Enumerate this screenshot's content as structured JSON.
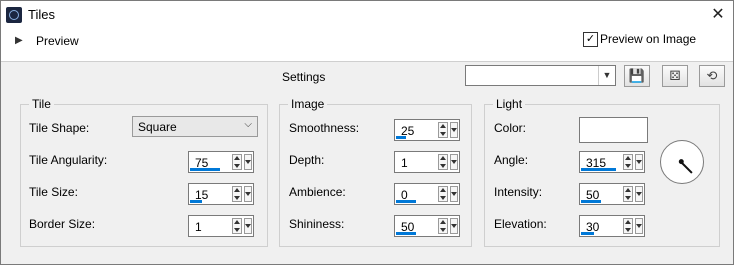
{
  "window": {
    "title": "Tiles",
    "close_label": "✕"
  },
  "preview": {
    "label": "Preview",
    "preview_on_image_label": "Preview on Image",
    "preview_on_image_checked": true
  },
  "settings": {
    "label": "Settings",
    "preset_value": ""
  },
  "toolbar": {
    "icons": [
      "save-icon",
      "randomize-icon",
      "reset-icon"
    ]
  },
  "tile": {
    "title": "Tile",
    "shape_label": "Tile Shape:",
    "shape_value": "Square",
    "angularity_label": "Tile Angularity:",
    "angularity_value": "75",
    "angularity_fraction": 0.75,
    "size_label": "Tile Size:",
    "size_value": "15",
    "size_fraction": 0.3,
    "border_label": "Border Size:",
    "border_value": "1",
    "border_fraction": 0.0
  },
  "image": {
    "title": "Image",
    "smoothness_label": "Smoothness:",
    "smoothness_value": "25",
    "smoothness_fraction": 0.25,
    "depth_label": "Depth:",
    "depth_value": "1",
    "depth_fraction": 0.0,
    "ambience_label": "Ambience:",
    "ambience_value": "0",
    "ambience_fraction": 0.5,
    "shininess_label": "Shininess:",
    "shininess_value": "50",
    "shininess_fraction": 0.5
  },
  "light": {
    "title": "Light",
    "color_label": "Color:",
    "color_value": "#ffffff",
    "angle_label": "Angle:",
    "angle_value": "315",
    "angle_fraction": 0.875,
    "intensity_label": "Intensity:",
    "intensity_value": "50",
    "intensity_fraction": 0.5,
    "elevation_label": "Elevation:",
    "elevation_value": "30",
    "elevation_fraction": 0.33
  },
  "colors": {
    "accent": "#0078d7"
  }
}
